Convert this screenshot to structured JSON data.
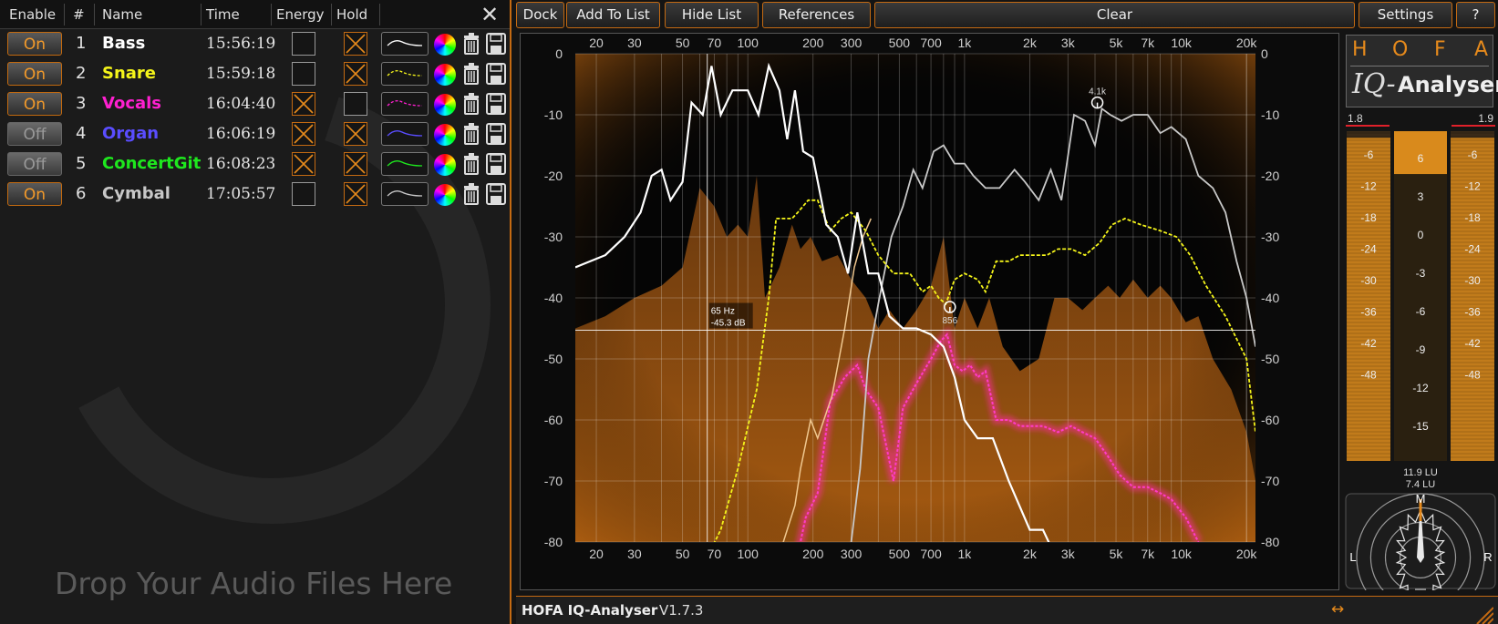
{
  "list_header": {
    "enable": "Enable",
    "number": "#",
    "name": "Name",
    "time": "Time",
    "energy": "Energy",
    "hold": "Hold"
  },
  "tracks": [
    {
      "toggle": "On",
      "number": "1",
      "name": "Bass",
      "time": "15:56:19",
      "color": "#ffffff",
      "energy": false,
      "hold": true,
      "line_style": "solid"
    },
    {
      "toggle": "On",
      "number": "2",
      "name": "Snare",
      "time": "15:59:18",
      "color": "#f5f51a",
      "energy": false,
      "hold": true,
      "line_style": "dashed"
    },
    {
      "toggle": "On",
      "number": "3",
      "name": "Vocals",
      "time": "16:04:40",
      "color": "#ff1fd0",
      "energy": true,
      "hold": false,
      "line_style": "dashed"
    },
    {
      "toggle": "Off",
      "number": "4",
      "name": "Organ",
      "time": "16:06:19",
      "color": "#5a4dff",
      "energy": true,
      "hold": true,
      "line_style": "solid"
    },
    {
      "toggle": "Off",
      "number": "5",
      "name": "ConcertGit",
      "time": "16:08:23",
      "color": "#1ee81e",
      "energy": true,
      "hold": true,
      "line_style": "solid"
    },
    {
      "toggle": "On",
      "number": "6",
      "name": "Cymbal",
      "time": "17:05:57",
      "color": "#c8c8c8",
      "energy": false,
      "hold": true,
      "line_style": "solid"
    }
  ],
  "drop_hint": "Drop Your Audio Files Here",
  "toolbar": {
    "dock": "Dock",
    "add_to_list": "Add To List",
    "hide_list": "Hide List",
    "references": "References",
    "clear": "Clear",
    "settings": "Settings",
    "help": "?"
  },
  "analyzer": {
    "freq_ticks": [
      "20",
      "30",
      "50",
      "70",
      "100",
      "200",
      "300",
      "500",
      "700",
      "1k",
      "2k",
      "3k",
      "5k",
      "7k",
      "10k",
      "20k"
    ],
    "freq_tick_values": [
      20,
      30,
      50,
      70,
      100,
      200,
      300,
      500,
      700,
      1000,
      2000,
      3000,
      5000,
      7000,
      10000,
      20000
    ],
    "db_ticks": [
      "0",
      "-10",
      "-20",
      "-30",
      "-40",
      "-50",
      "-60",
      "-70",
      "-80"
    ],
    "db_tick_values": [
      0,
      -10,
      -20,
      -30,
      -40,
      -50,
      -60,
      -70,
      -80
    ],
    "x_range": [
      16,
      22000
    ],
    "y_range": [
      -80,
      0
    ],
    "cursor_freq": "65 Hz",
    "cursor_db": "-45.3 dB",
    "marker_peak_label": "4.1k",
    "marker_peak_point": [
      4100,
      -8
    ],
    "marker_dip_label": "856",
    "marker_dip_point": [
      856,
      -41.5
    ],
    "crosshair": [
      65,
      -45.3
    ],
    "colors": {
      "background_glow": "#c46a12",
      "bass": "#ffffff",
      "snare": "#f5f51a",
      "vocals": "#ff3cc8",
      "cymbal": "#c8c8c8",
      "organ_fill": "#8a4a12",
      "aux": "#f0c890"
    },
    "series": {
      "bass": [
        [
          16,
          -35
        ],
        [
          22,
          -33
        ],
        [
          27,
          -30
        ],
        [
          32,
          -26
        ],
        [
          36,
          -20
        ],
        [
          40,
          -19
        ],
        [
          44,
          -24
        ],
        [
          50,
          -21
        ],
        [
          55,
          -8
        ],
        [
          62,
          -10
        ],
        [
          68,
          -2
        ],
        [
          75,
          -10
        ],
        [
          85,
          -6
        ],
        [
          100,
          -6
        ],
        [
          112,
          -10
        ],
        [
          125,
          -2
        ],
        [
          140,
          -6
        ],
        [
          152,
          -14
        ],
        [
          165,
          -6
        ],
        [
          180,
          -16
        ],
        [
          200,
          -17
        ],
        [
          230,
          -28
        ],
        [
          260,
          -30
        ],
        [
          290,
          -36
        ],
        [
          320,
          -26
        ],
        [
          360,
          -36
        ],
        [
          400,
          -36
        ],
        [
          450,
          -43
        ],
        [
          520,
          -45
        ],
        [
          600,
          -45
        ],
        [
          700,
          -46
        ],
        [
          800,
          -48
        ],
        [
          900,
          -53
        ],
        [
          1000,
          -60
        ],
        [
          1150,
          -63
        ],
        [
          1350,
          -63
        ],
        [
          1600,
          -70
        ],
        [
          2000,
          -78
        ],
        [
          2300,
          -78
        ],
        [
          2600,
          -82
        ]
      ],
      "snare": [
        [
          66,
          -82
        ],
        [
          75,
          -78
        ],
        [
          90,
          -68
        ],
        [
          110,
          -55
        ],
        [
          125,
          -40
        ],
        [
          135,
          -27
        ],
        [
          160,
          -27
        ],
        [
          170,
          -26
        ],
        [
          190,
          -24
        ],
        [
          210,
          -24
        ],
        [
          240,
          -29
        ],
        [
          270,
          -27
        ],
        [
          300,
          -26
        ],
        [
          350,
          -29
        ],
        [
          400,
          -33
        ],
        [
          470,
          -36
        ],
        [
          560,
          -36
        ],
        [
          640,
          -39
        ],
        [
          700,
          -38
        ],
        [
          760,
          -40
        ],
        [
          820,
          -41
        ],
        [
          900,
          -37
        ],
        [
          1000,
          -36
        ],
        [
          1150,
          -37
        ],
        [
          1250,
          -39
        ],
        [
          1400,
          -34
        ],
        [
          1600,
          -34
        ],
        [
          1800,
          -33
        ],
        [
          2100,
          -33
        ],
        [
          2400,
          -33
        ],
        [
          2700,
          -32
        ],
        [
          3100,
          -32
        ],
        [
          3600,
          -33
        ],
        [
          4200,
          -31
        ],
        [
          4800,
          -28
        ],
        [
          5500,
          -27
        ],
        [
          6500,
          -28
        ],
        [
          8000,
          -29
        ],
        [
          9500,
          -30
        ],
        [
          11000,
          -33
        ],
        [
          13000,
          -38
        ],
        [
          16000,
          -43
        ],
        [
          20000,
          -50
        ],
        [
          22000,
          -62
        ]
      ],
      "vocals": [
        [
          170,
          -82
        ],
        [
          185,
          -76
        ],
        [
          210,
          -72
        ],
        [
          240,
          -57
        ],
        [
          280,
          -53
        ],
        [
          320,
          -51
        ],
        [
          350,
          -55
        ],
        [
          400,
          -58
        ],
        [
          440,
          -65
        ],
        [
          470,
          -70
        ],
        [
          520,
          -58
        ],
        [
          600,
          -54
        ],
        [
          700,
          -50
        ],
        [
          780,
          -47
        ],
        [
          830,
          -46
        ],
        [
          900,
          -51
        ],
        [
          980,
          -52
        ],
        [
          1060,
          -51
        ],
        [
          1150,
          -53
        ],
        [
          1250,
          -52
        ],
        [
          1400,
          -60
        ],
        [
          1600,
          -60
        ],
        [
          1800,
          -61
        ],
        [
          2000,
          -61
        ],
        [
          2300,
          -61
        ],
        [
          2700,
          -62
        ],
        [
          3100,
          -61
        ],
        [
          3500,
          -62
        ],
        [
          4000,
          -63
        ],
        [
          4600,
          -66
        ],
        [
          5200,
          -69
        ],
        [
          6000,
          -71
        ],
        [
          7000,
          -71
        ],
        [
          8000,
          -72
        ],
        [
          9000,
          -73
        ],
        [
          10500,
          -76
        ],
        [
          12000,
          -80
        ]
      ],
      "cymbal": [
        [
          300,
          -80
        ],
        [
          330,
          -68
        ],
        [
          360,
          -50
        ],
        [
          400,
          -41
        ],
        [
          460,
          -30
        ],
        [
          520,
          -25
        ],
        [
          580,
          -19
        ],
        [
          640,
          -22
        ],
        [
          720,
          -16
        ],
        [
          800,
          -15
        ],
        [
          900,
          -18
        ],
        [
          1000,
          -18
        ],
        [
          1100,
          -20
        ],
        [
          1250,
          -22
        ],
        [
          1450,
          -22
        ],
        [
          1700,
          -19
        ],
        [
          1900,
          -21
        ],
        [
          2200,
          -24
        ],
        [
          2500,
          -19
        ],
        [
          2800,
          -24
        ],
        [
          3200,
          -10
        ],
        [
          3600,
          -11
        ],
        [
          4000,
          -15
        ],
        [
          4300,
          -9
        ],
        [
          4700,
          -10
        ],
        [
          5300,
          -11
        ],
        [
          6000,
          -10
        ],
        [
          7000,
          -10
        ],
        [
          8000,
          -13
        ],
        [
          9000,
          -12
        ],
        [
          10500,
          -14
        ],
        [
          12000,
          -20
        ],
        [
          14000,
          -22
        ],
        [
          16000,
          -26
        ],
        [
          18000,
          -34
        ],
        [
          20000,
          -40
        ],
        [
          22000,
          -48
        ]
      ],
      "aux": [
        [
          140,
          -82
        ],
        [
          165,
          -74
        ],
        [
          175,
          -68
        ],
        [
          195,
          -60
        ],
        [
          210,
          -63
        ],
        [
          245,
          -56
        ],
        [
          280,
          -45
        ],
        [
          310,
          -35
        ],
        [
          340,
          -30
        ],
        [
          370,
          -27
        ]
      ],
      "organ_fill": [
        [
          16,
          -45
        ],
        [
          22,
          -43
        ],
        [
          30,
          -40
        ],
        [
          40,
          -38
        ],
        [
          50,
          -35
        ],
        [
          60,
          -22
        ],
        [
          70,
          -25
        ],
        [
          80,
          -30
        ],
        [
          90,
          -28
        ],
        [
          100,
          -30
        ],
        [
          110,
          -20
        ],
        [
          120,
          -40
        ],
        [
          140,
          -35
        ],
        [
          160,
          -28
        ],
        [
          175,
          -32
        ],
        [
          195,
          -30
        ],
        [
          220,
          -34
        ],
        [
          260,
          -33
        ],
        [
          300,
          -37
        ],
        [
          350,
          -40
        ],
        [
          400,
          -45
        ],
        [
          450,
          -42
        ],
        [
          520,
          -45
        ],
        [
          600,
          -42
        ],
        [
          700,
          -38
        ],
        [
          800,
          -30
        ],
        [
          900,
          -45
        ],
        [
          1000,
          -40
        ],
        [
          1150,
          -45
        ],
        [
          1300,
          -40
        ],
        [
          1500,
          -48
        ],
        [
          1800,
          -52
        ],
        [
          2200,
          -50
        ],
        [
          2600,
          -40
        ],
        [
          3000,
          -40
        ],
        [
          3500,
          -42
        ],
        [
          4000,
          -40
        ],
        [
          4600,
          -38
        ],
        [
          5200,
          -40
        ],
        [
          6000,
          -37
        ],
        [
          7000,
          -40
        ],
        [
          8000,
          -38
        ],
        [
          9000,
          -40
        ],
        [
          10500,
          -44
        ],
        [
          12000,
          -43
        ],
        [
          14000,
          -50
        ],
        [
          17000,
          -55
        ],
        [
          20000,
          -62
        ],
        [
          22000,
          -70
        ]
      ]
    }
  },
  "meters": {
    "logo_letters": [
      "H",
      "O",
      "F",
      "A"
    ],
    "logo_iq": "IQ-",
    "logo_name": "Analyser",
    "left_peak": "1.8",
    "right_peak": "1.9",
    "side_ticks": [
      "-6",
      "-12",
      "-18",
      "-24",
      "-30",
      "-36",
      "-42",
      "-48"
    ],
    "center_ticks": [
      "6",
      "3",
      "0",
      "-3",
      "-6",
      "-9",
      "-12",
      "-15"
    ],
    "lu_short": "11.9 LU",
    "lu_long": "7.4 LU",
    "left_level": 0.98,
    "right_level": 0.98,
    "center_level": 0.13,
    "gonio_labels": {
      "top": "M",
      "left": "L",
      "right": "R",
      "bottom": "S"
    },
    "colors": {
      "meter_fill": "#d98a1c",
      "meter_bg": "#3a2a18"
    }
  },
  "status": {
    "brand": "HOFA IQ-Analyser",
    "version": "V1.7.3"
  }
}
